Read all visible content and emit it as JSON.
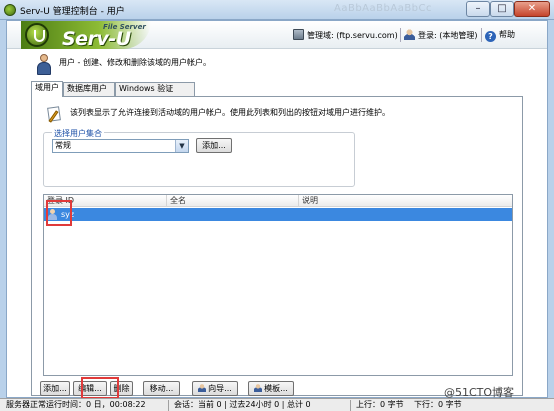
{
  "window": {
    "title": "Serv-U 管理控制台 - 用户",
    "ghost_text": "AaBbAaBbAaBbCc",
    "min_label": "–",
    "max_label": "□",
    "close_label": "✕"
  },
  "header": {
    "logo_text": "Serv-U",
    "logo_subtitle": "File Server",
    "domain_label": "管理域: (ftp.servu.com)",
    "login_label": "登录: (本地管理)",
    "help_label": "帮助"
  },
  "page": {
    "description": "用户 - 创建、修改和删除该域的用户帐户。"
  },
  "tabs": [
    {
      "label": "域用户"
    },
    {
      "label": "数据库用户"
    },
    {
      "label": "Windows 验证"
    }
  ],
  "panel": {
    "info_text": "该列表显示了允许连接到活动域的用户帐户。使用此列表和列出的按钮对域用户进行维护。",
    "group_legend": "选择用户集合",
    "collection_value": "常规",
    "add_collection_button": "添加..."
  },
  "list": {
    "columns": [
      "登录 ID",
      "全名",
      "说明"
    ],
    "rows": [
      {
        "login_id": "syz",
        "full_name": "",
        "description": ""
      }
    ]
  },
  "buttons": {
    "add": "添加...",
    "edit": "编辑...",
    "delete": "删除",
    "move": "移动...",
    "wizard": "向导...",
    "template": "模板..."
  },
  "status": {
    "uptime": "服务器正常运行时间：0 日，00:08:22",
    "sessions": "会话：当前 0 | 过去24小时 0 | 总计 0",
    "upload": "上行：0 字节",
    "download": "下行：0 字节"
  },
  "watermark": "@51CTO博客",
  "colors": {
    "selection": "#3b88e0",
    "highlight_box": "#e03a3a",
    "accent_green": "#8dbb35"
  }
}
